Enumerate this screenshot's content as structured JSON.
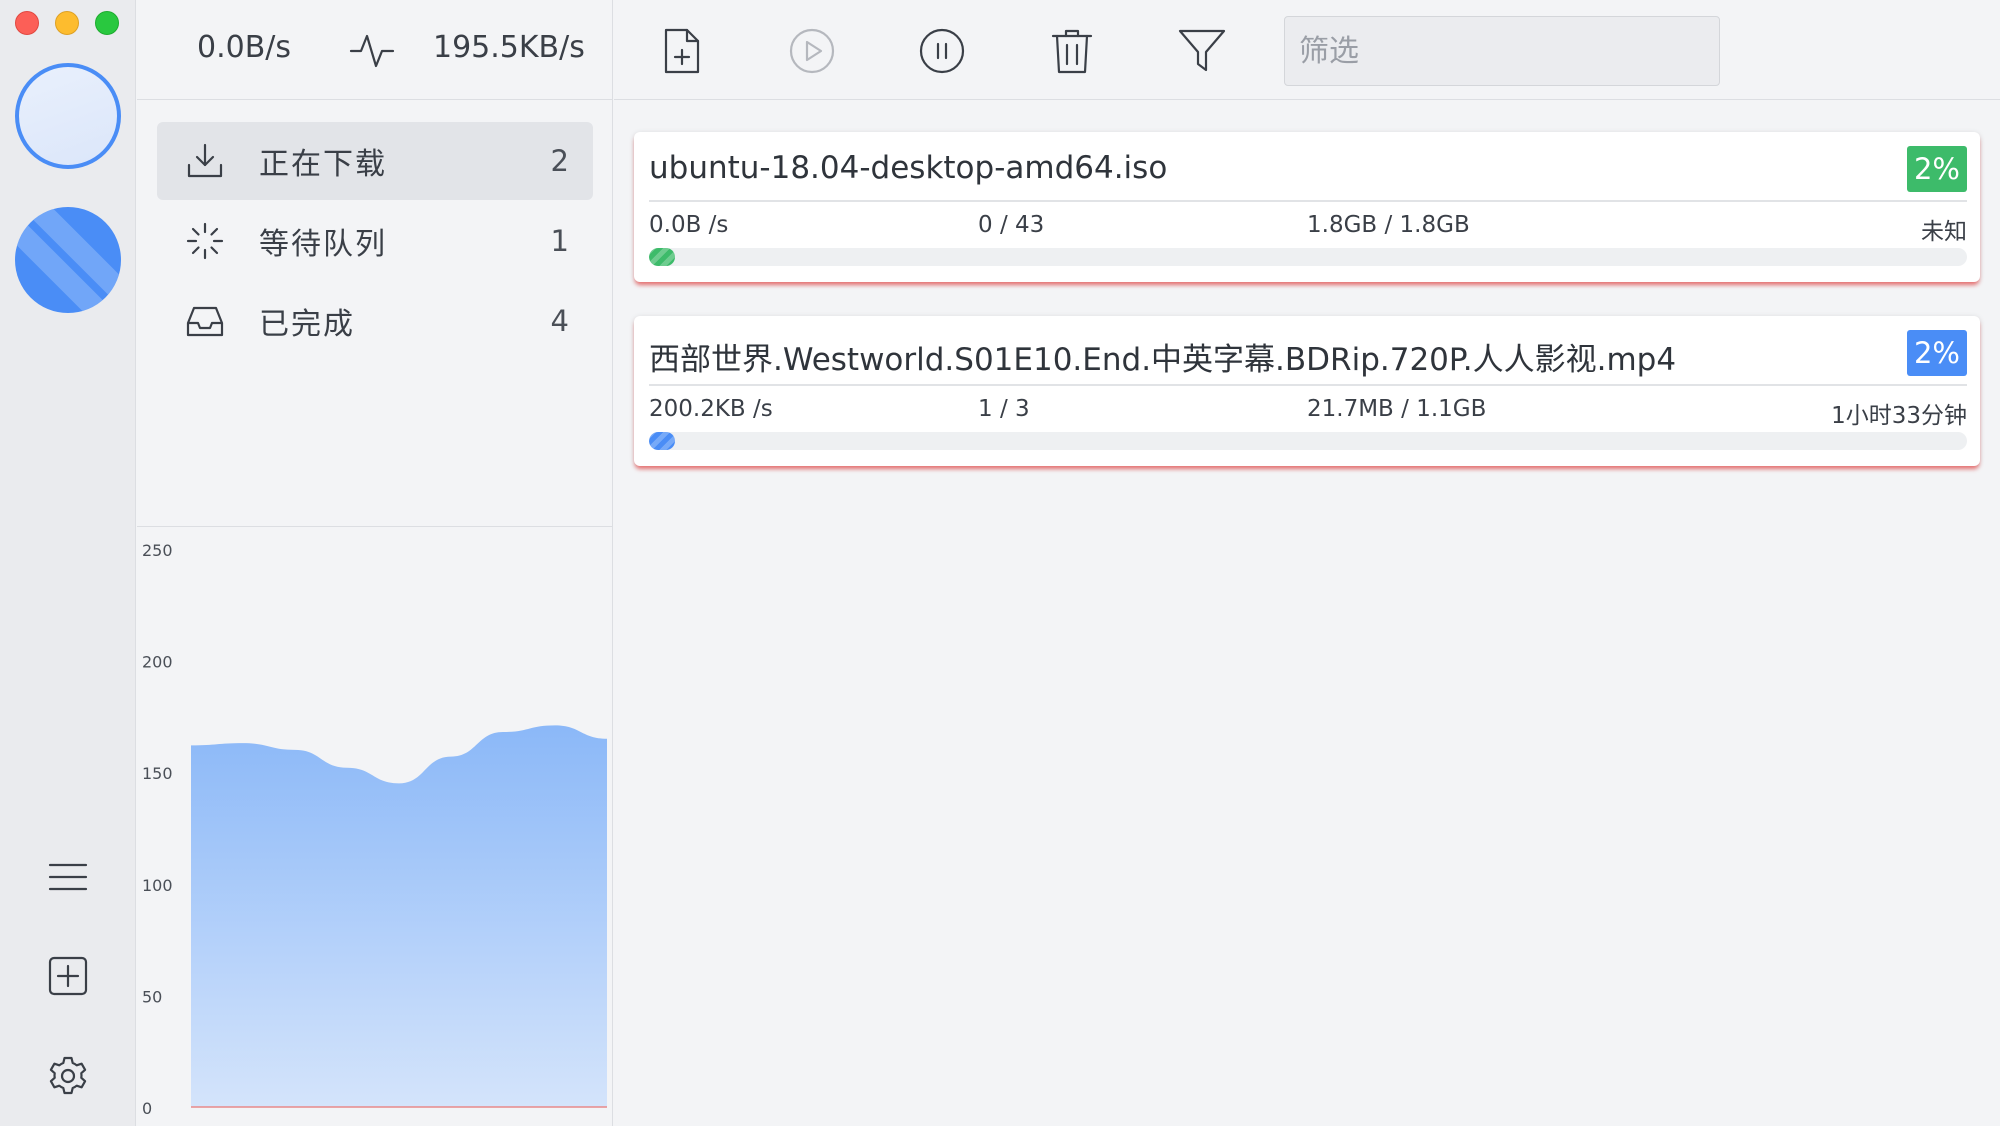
{
  "colors": {
    "accent": "#4a8df6",
    "success": "#3dbb6a",
    "error_underline": "#e84c4c",
    "chart_fill_top": "#8bb8f8",
    "chart_fill_bottom": "#d4e4fb"
  },
  "rail": {
    "window_controls": [
      "close",
      "minimize",
      "zoom"
    ],
    "bottom_icons": [
      "menu-icon",
      "add-task-icon",
      "settings-icon"
    ]
  },
  "speeds": {
    "download": "0.0B/s",
    "upload": "195.5KB/s"
  },
  "nav": {
    "items": [
      {
        "icon": "download-icon",
        "label": "正在下载",
        "count": "2",
        "active": true
      },
      {
        "icon": "loading-icon",
        "label": "等待队列",
        "count": "1",
        "active": false
      },
      {
        "icon": "inbox-icon",
        "label": "已完成",
        "count": "4",
        "active": false
      }
    ]
  },
  "toolbar": {
    "buttons": [
      "new-file-icon",
      "resume-icon",
      "pause-icon",
      "delete-icon",
      "filter-icon"
    ],
    "filter_placeholder": "筛选"
  },
  "tasks": [
    {
      "name": "ubuntu-18.04-desktop-amd64.iso",
      "percent": "2%",
      "progress": 0.02,
      "speed": "0.0B /s",
      "connections": "0 / 43",
      "size": "1.8GB / 1.8GB",
      "eta": "未知",
      "color": "#3dbb6a"
    },
    {
      "name": "西部世界.Westworld.S01E10.End.中英字幕.BDRip.720P.人人影视.mp4",
      "percent": "2%",
      "progress": 0.02,
      "speed": "200.2KB /s",
      "connections": "1 / 3",
      "size": "21.7MB / 1.1GB",
      "eta": "1小时33分钟",
      "color": "#4a8df6"
    }
  ],
  "chart_data": {
    "type": "area",
    "title": "",
    "xlabel": "",
    "ylabel": "",
    "ylim": [
      0,
      250
    ],
    "yticks": [
      "250",
      "200",
      "150",
      "100",
      "50",
      "0"
    ],
    "grid": false,
    "x": [
      0,
      1,
      2,
      3,
      4,
      5,
      6,
      7,
      8
    ],
    "series": [
      {
        "values": [
          162,
          163,
          160,
          152,
          145,
          157,
          168,
          171,
          165
        ]
      }
    ]
  }
}
